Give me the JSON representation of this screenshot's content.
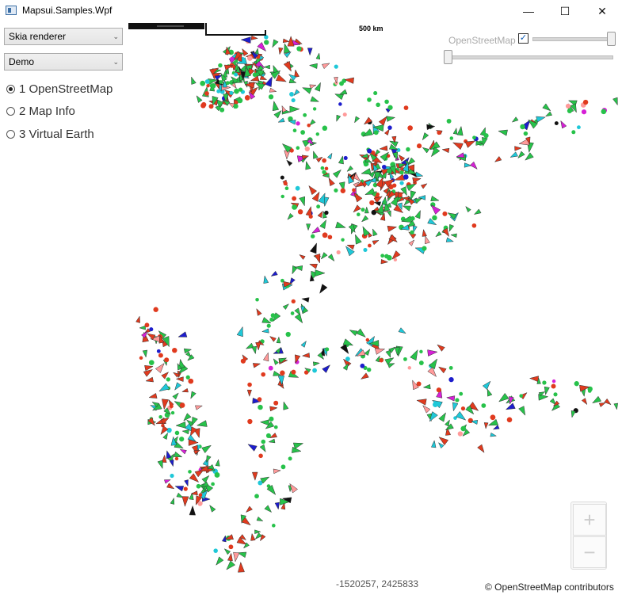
{
  "window": {
    "title": "Mapsui.Samples.Wpf",
    "minimize": "—",
    "maximize": "☐",
    "close": "✕"
  },
  "sidebar": {
    "renderer": {
      "value": "Skia renderer",
      "chevron": "⌄"
    },
    "category": {
      "value": "Demo",
      "chevron": "⌄"
    },
    "samples": [
      {
        "label": "1 OpenStreetMap",
        "selected": true
      },
      {
        "label": "2 Map Info",
        "selected": false
      },
      {
        "label": "3 Virtual Earth",
        "selected": false
      }
    ]
  },
  "map": {
    "scale_label": "500 km",
    "layer": {
      "name": "OpenStreetMap",
      "checked": "✓"
    },
    "zoom": {
      "in": "+",
      "out": "−"
    },
    "coordinates": "-1520257, 2425833",
    "attribution": "© OpenStreetMap contributors",
    "symbol_colors": [
      "#27c24a",
      "#e03a1e",
      "#1fc8d8",
      "#1d1dcc",
      "#d620d6",
      "#111111",
      "#ff9a9a"
    ]
  }
}
